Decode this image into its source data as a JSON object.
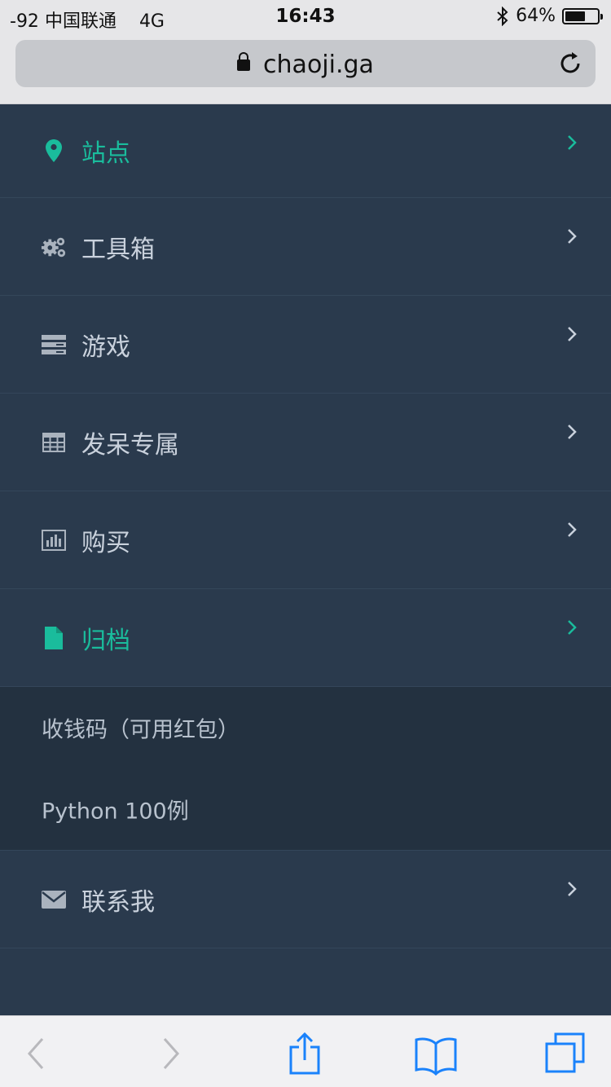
{
  "status_bar": {
    "signal": "-92",
    "carrier": "中国联通",
    "network": "4G",
    "time": "16:43",
    "battery_percent": "64%",
    "battery_level": 0.64
  },
  "browser": {
    "url": "chaoji.ga"
  },
  "menu": {
    "items": [
      {
        "label": "站点",
        "icon": "map-marker-icon",
        "active": true
      },
      {
        "label": "工具箱",
        "icon": "gears-icon",
        "active": false
      },
      {
        "label": "游戏",
        "icon": "server-icon",
        "active": false
      },
      {
        "label": "发呆专属",
        "icon": "table-icon",
        "active": false
      },
      {
        "label": "购买",
        "icon": "bar-chart-icon",
        "active": false
      },
      {
        "label": "归档",
        "icon": "file-icon",
        "active": true
      }
    ],
    "submenu": [
      {
        "label": "收钱码（可用红包）"
      },
      {
        "label": "Python 100例"
      }
    ],
    "contact": {
      "label": "联系我",
      "icon": "envelope-icon"
    }
  },
  "colors": {
    "accent": "#1abc9c",
    "background": "#2a3a4d",
    "submenu_bg": "#233140",
    "text": "#c9d1dc"
  }
}
